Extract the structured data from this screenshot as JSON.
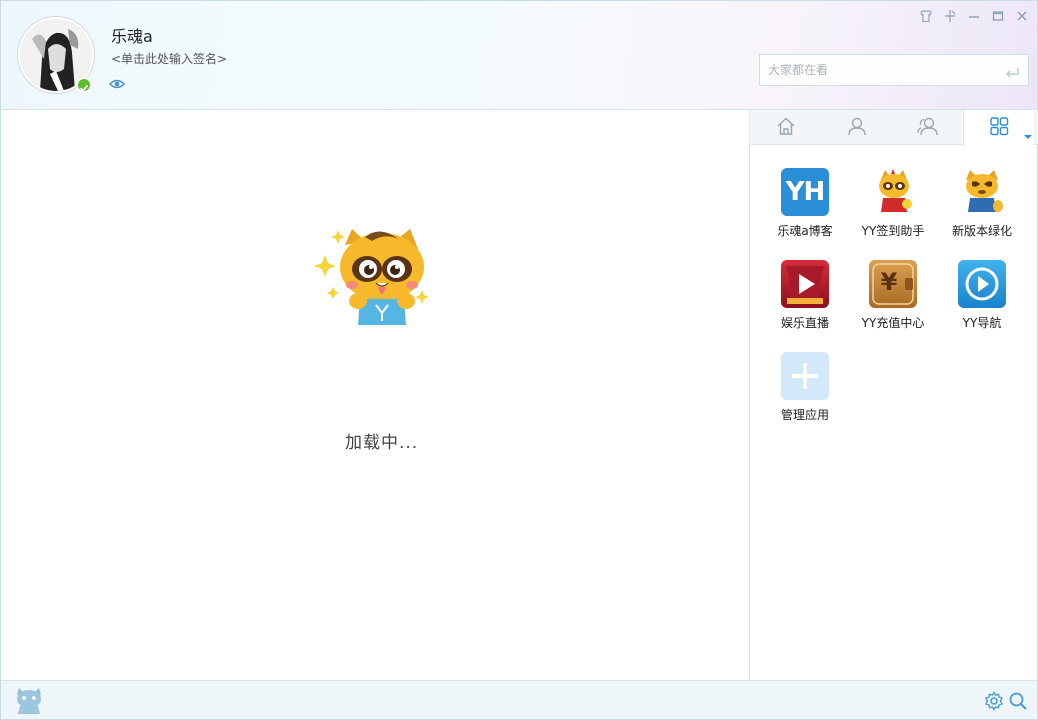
{
  "profile": {
    "username": "乐魂a",
    "signature": "<单击此处输入签名>",
    "status": "online",
    "visibility_icon": "eye-icon"
  },
  "window_controls": [
    "skin-icon",
    "pin-icon",
    "minimize-icon",
    "maximize-icon",
    "close-icon"
  ],
  "search": {
    "placeholder": "大家都在看",
    "submit_icon": "enter-icon"
  },
  "main": {
    "loading_text": "加载中..."
  },
  "side_panel": {
    "tabs": [
      {
        "name": "home",
        "icon": "home-icon",
        "active": false
      },
      {
        "name": "friends",
        "icon": "user-icon",
        "active": false
      },
      {
        "name": "groups",
        "icon": "group-icon",
        "active": false
      },
      {
        "name": "apps",
        "icon": "grid-icon",
        "active": true
      }
    ],
    "apps": [
      {
        "label": "乐魂a博客",
        "icon": "yh-blog-icon",
        "icon_text": "YH"
      },
      {
        "label": "YY签到助手",
        "icon": "checkin-mascot-icon"
      },
      {
        "label": "新版本绿化",
        "icon": "mascot-icon"
      },
      {
        "label": "娱乐直播",
        "icon": "live-play-icon"
      },
      {
        "label": "YY充值中心",
        "icon": "wallet-icon",
        "icon_text": "¥"
      },
      {
        "label": "YY导航",
        "icon": "navigation-icon"
      },
      {
        "label": "管理应用",
        "icon": "add-icon"
      }
    ]
  },
  "footer": {
    "left_icon": "mascot-icon",
    "right_icons": [
      "settings-icon",
      "search-icon"
    ]
  },
  "colors": {
    "accent": "#2a8fd6",
    "online": "#5cbf2a",
    "header_bg": "#eef8fc"
  }
}
